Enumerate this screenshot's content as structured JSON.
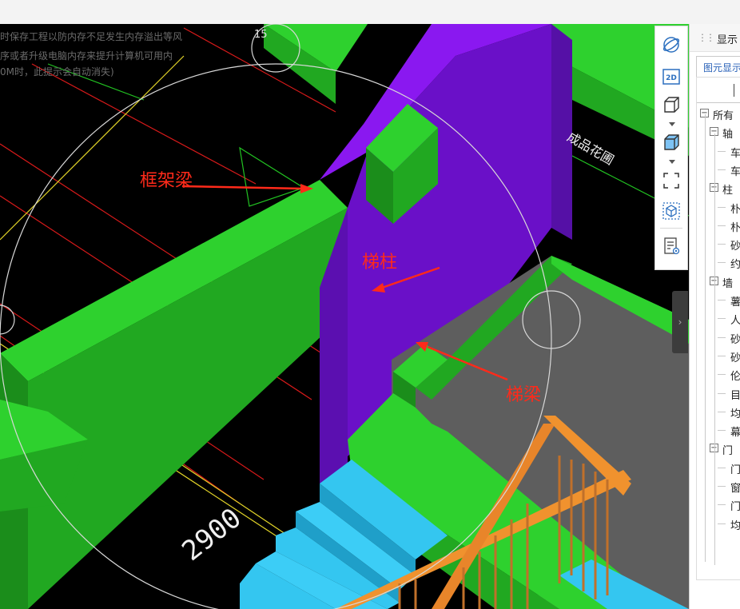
{
  "warning": {
    "lines": [
      "时保存工程以防内存不足发生内存溢出等风",
      "序或者升级电脑内存来提升计算机可用内",
      "0M时，此提示会自动消失)"
    ]
  },
  "annotations": {
    "frame_beam": "框架梁",
    "stair_column": "梯柱",
    "stair_beam": "梯梁"
  },
  "drawing_texts": {
    "area_label": "成品花圃",
    "dimension": "2900",
    "grid_tag": "15"
  },
  "colors": {
    "beam": "#2dc52d",
    "column": "#6a10c8",
    "stair": "#34c6f0",
    "railing": "#f0922e",
    "annotation": "#ff2a1a",
    "slab": "#5e5e5e"
  },
  "toolbar": {
    "icons": [
      "orbit-icon",
      "2d-icon",
      "3d-box-icon",
      "3d-shaded-box-icon",
      "fit-view-icon",
      "element-view-icon",
      "properties-icon"
    ]
  },
  "panel": {
    "title": "显示",
    "tab_label": "图元显示",
    "tree": [
      {
        "label": "所有",
        "level": 0,
        "expander": "−"
      },
      {
        "label": "轴",
        "level": 1,
        "expander": "−"
      },
      {
        "label": "车",
        "level": 2
      },
      {
        "label": "车",
        "level": 2
      },
      {
        "label": "柱",
        "level": 1,
        "expander": "−"
      },
      {
        "label": "朴",
        "level": 2
      },
      {
        "label": "朴",
        "level": 2
      },
      {
        "label": "砂",
        "level": 2
      },
      {
        "label": "约",
        "level": 2
      },
      {
        "label": "墙",
        "level": 1,
        "expander": "−"
      },
      {
        "label": "薯",
        "level": 2
      },
      {
        "label": "人",
        "level": 2
      },
      {
        "label": "砂",
        "level": 2
      },
      {
        "label": "砂",
        "level": 2
      },
      {
        "label": "伦",
        "level": 2
      },
      {
        "label": "目",
        "level": 2
      },
      {
        "label": "均",
        "level": 2
      },
      {
        "label": "幕",
        "level": 2
      },
      {
        "label": "门",
        "level": 1,
        "expander": "−"
      },
      {
        "label": "门",
        "level": 2
      },
      {
        "label": "窗",
        "level": 2
      },
      {
        "label": "门",
        "level": 2
      },
      {
        "label": "均",
        "level": 2
      }
    ]
  }
}
